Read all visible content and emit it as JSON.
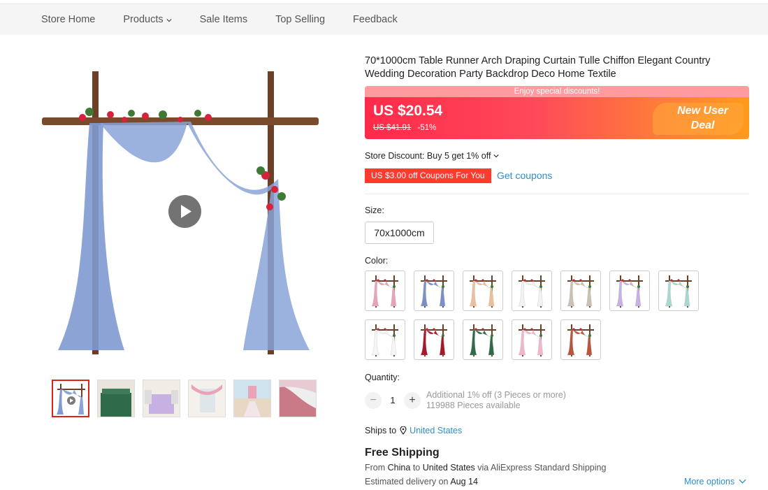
{
  "nav": {
    "items": [
      "Store Home",
      "Products",
      "Sale Items",
      "Top Selling",
      "Feedback"
    ]
  },
  "product": {
    "title": "70*1000cm Table Runner Arch Draping Curtain Tulle Chiffon Elegant Country Wedding Decoration Party Backdrop Deco Home Textile"
  },
  "promo": {
    "banner": "Enjoy special discounts!",
    "price": "US $20.54",
    "old_price": "US $41.91",
    "discount": "-51%",
    "deal_line1": "New User",
    "deal_line2": "Deal"
  },
  "store_discount": "Store Discount: Buy 5 get 1% off",
  "coupon": {
    "tag": "US $3.00 off Coupons For You",
    "link": "Get coupons"
  },
  "size": {
    "label": "Size:",
    "options": [
      "70x1000cm"
    ]
  },
  "color": {
    "label": "Color:",
    "swatches": [
      "#e8a3b8",
      "#7b8fc8",
      "#e9c09a",
      "#f2f2f2",
      "#c9c2b3",
      "#c7b1e2",
      "#a8d8d0",
      "#f6f6f6",
      "#a8182b",
      "#2f6a4a",
      "#f0b6cc",
      "#b8553c"
    ]
  },
  "quantity": {
    "label": "Quantity:",
    "value": "1",
    "minus": "−",
    "plus": "+",
    "note1": "Additional 1% off (3 Pieces or more)",
    "note2": "119988 Pieces available"
  },
  "shipping": {
    "ships_to": "Ships to",
    "country": "United States",
    "title": "Free Shipping",
    "from_prefix": "From",
    "from": "China",
    "to_prefix": "to",
    "to": "United States",
    "via": "via AliExpress Standard Shipping",
    "est_prefix": "Estimated delivery on",
    "est_date": "Aug 14",
    "more": "More options"
  },
  "colors": {
    "accent_red": "#ff2a4a",
    "link_blue": "#2e8fcf",
    "coupon_red": "#ff3a2e"
  }
}
